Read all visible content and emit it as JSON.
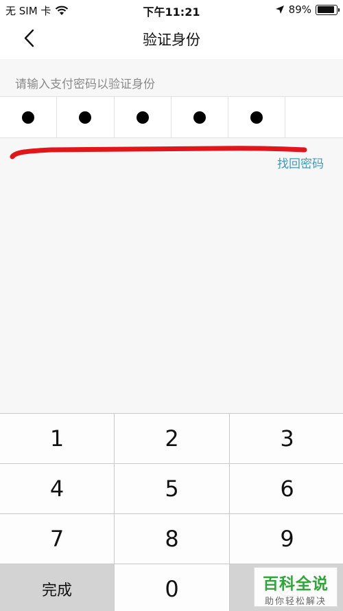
{
  "status_bar": {
    "carrier": "无 SIM 卡",
    "time": "下午11:21",
    "battery_text": "89%",
    "battery_level": 0.89
  },
  "nav": {
    "title": "验证身份"
  },
  "prompt": "请输入支付密码以验证身份",
  "pin": {
    "filled": 5,
    "length": 6
  },
  "forgot_link": "找回密码",
  "keypad": {
    "keys": [
      "1",
      "2",
      "3",
      "4",
      "5",
      "6",
      "7",
      "8",
      "9"
    ],
    "done_label": "完成",
    "zero": "0"
  },
  "watermark": {
    "main": "百科全说",
    "sub": "助你轻松解决"
  },
  "colors": {
    "link": "#3b9bc4",
    "stroke": "#e0161b",
    "watermark": "#2fa63a"
  },
  "icons": [
    "wifi-icon",
    "location-icon",
    "battery-icon",
    "back-arrow-icon",
    "backspace-icon"
  ]
}
